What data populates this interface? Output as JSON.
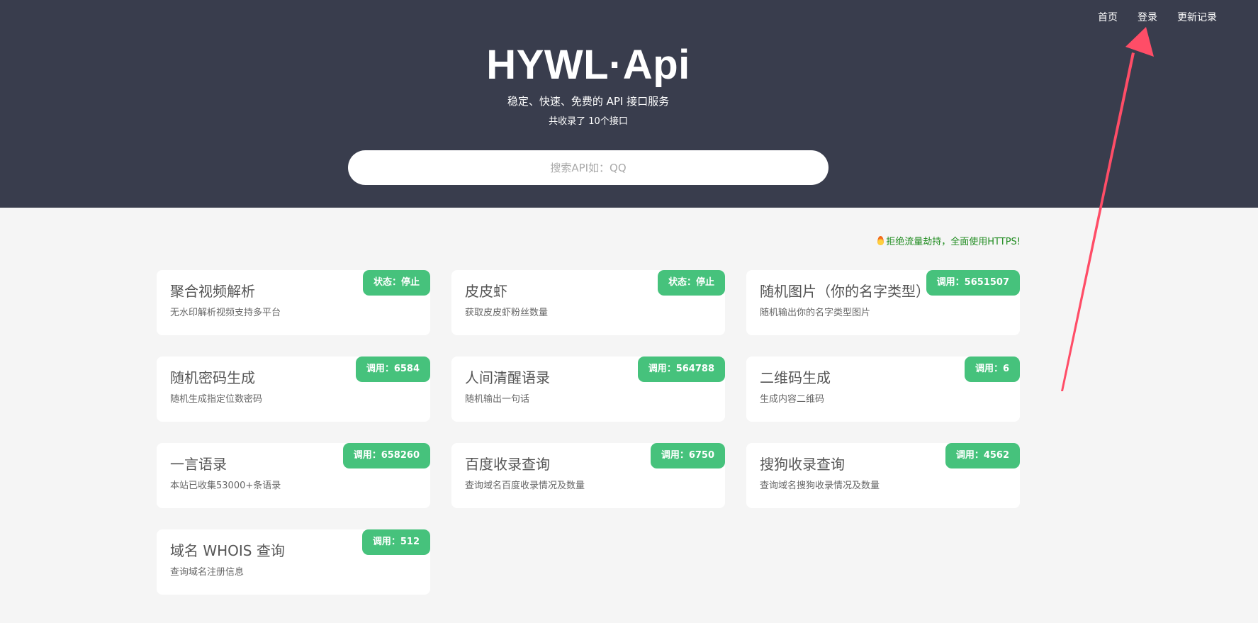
{
  "nav": {
    "items": [
      "首页",
      "登录",
      "更新记录"
    ]
  },
  "hero": {
    "brand": "HYWL·Api",
    "subtitle": "稳定、快速、免费的 API 接口服务",
    "count": "共收录了 10个接口"
  },
  "search": {
    "placeholder": "搜索API如：QQ"
  },
  "notice": {
    "text": "拒绝流量劫持，全面使用HTTPS!"
  },
  "cards": [
    {
      "title": "聚合视频解析",
      "desc": "无水印解析视频支持多平台",
      "badge": "状态：停止"
    },
    {
      "title": "皮皮虾",
      "desc": "获取皮皮虾粉丝数量",
      "badge": "状态：停止"
    },
    {
      "title": "随机图片（你的名字类型）",
      "desc": "随机输出你的名字类型图片",
      "badge": "调用：5651507"
    },
    {
      "title": "随机密码生成",
      "desc": "随机生成指定位数密码",
      "badge": "调用：6584"
    },
    {
      "title": "人间清醒语录",
      "desc": "随机输出一句话",
      "badge": "调用：564788"
    },
    {
      "title": "二维码生成",
      "desc": "生成内容二维码",
      "badge": "调用：6"
    },
    {
      "title": "一言语录",
      "desc": "本站已收集53000+条语录",
      "badge": "调用：658260"
    },
    {
      "title": "百度收录查询",
      "desc": "查询域名百度收录情况及数量",
      "badge": "调用：6750"
    },
    {
      "title": "搜狗收录查询",
      "desc": "查询域名搜狗收录情况及数量",
      "badge": "调用：4562"
    },
    {
      "title": "域名 WHOIS 查询",
      "desc": "查询域名注册信息",
      "badge": "调用：512"
    }
  ],
  "colors": {
    "header_bg": "#393d4d",
    "badge_green": "#46c27c",
    "notice_green": "#1e8b1e",
    "arrow_red": "#ff4d67"
  }
}
